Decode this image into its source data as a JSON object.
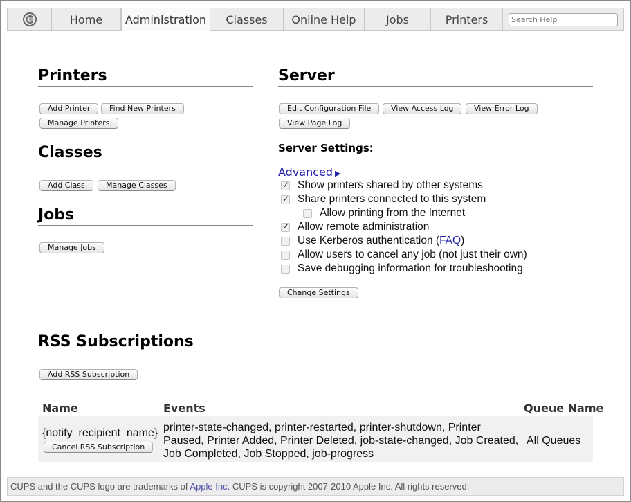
{
  "nav": {
    "tabs": [
      {
        "label": "Home"
      },
      {
        "label": "Administration",
        "active": true
      },
      {
        "label": "Classes"
      },
      {
        "label": "Online Help"
      },
      {
        "label": "Jobs"
      },
      {
        "label": "Printers"
      }
    ],
    "search_placeholder": "Search Help"
  },
  "printers": {
    "title": "Printers",
    "add_printer": "Add Printer",
    "find_new_printers": "Find New Printers",
    "manage_printers": "Manage Printers"
  },
  "classes": {
    "title": "Classes",
    "add_class": "Add Class",
    "manage_classes": "Manage Classes"
  },
  "jobs": {
    "title": "Jobs",
    "manage_jobs": "Manage Jobs"
  },
  "server": {
    "title": "Server",
    "edit_config": "Edit Configuration File",
    "view_access_log": "View Access Log",
    "view_error_log": "View Error Log",
    "view_page_log": "View Page Log",
    "settings_title": "Server Settings:",
    "advanced": "Advanced",
    "options": {
      "share_printers_other": {
        "label": "Show printers shared by other systems",
        "checked": true
      },
      "share_printers_this": {
        "label": "Share printers connected to this system",
        "checked": true
      },
      "allow_internet": {
        "label": "Allow printing from the Internet",
        "checked": false
      },
      "remote_admin": {
        "label": "Allow remote administration",
        "checked": true
      },
      "kerberos": {
        "label_before": "Use Kerberos authentication (",
        "link": "FAQ",
        "label_after": ")",
        "checked": false
      },
      "cancel_any_job": {
        "label": "Allow users to cancel any job (not just their own)",
        "checked": false
      },
      "debug_logging": {
        "label": "Save debugging information for troubleshooting",
        "checked": false
      }
    },
    "change_settings": "Change Settings"
  },
  "rss": {
    "title": "RSS Subscriptions",
    "add_subscription": "Add RSS Subscription",
    "columns": {
      "name": "Name",
      "events": "Events",
      "queue": "Queue Name"
    },
    "rows": [
      {
        "name": "{notify_recipient_name}",
        "cancel": "Cancel RSS Subscription",
        "events_line1": "printer-state-changed, printer-restarted, printer-shutdown, Printer",
        "events_line2": "Paused, Printer Added, Printer Deleted, job-state-changed, Job Created,",
        "events_line3": "Job Completed, Job Stopped, job-progress",
        "queue": "All Queues"
      }
    ]
  },
  "footer": {
    "text_before": "CUPS and the CUPS logo are trademarks of ",
    "link": "Apple Inc.",
    "text_after": " CUPS is copyright 2007-2010 Apple Inc. All rights reserved."
  }
}
